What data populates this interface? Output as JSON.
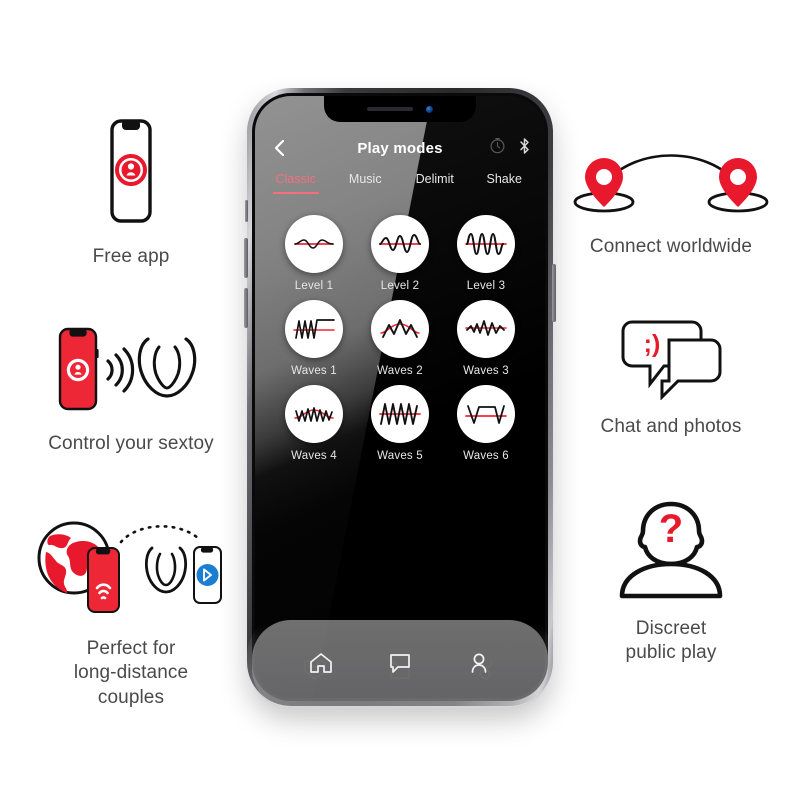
{
  "phone": {
    "header": {
      "back_icon": "chevron-left-icon",
      "title": "Play modes",
      "timer_icon": "timer-icon",
      "bluetooth_icon": "bluetooth-icon"
    },
    "tabs": [
      {
        "label": "Classic",
        "active": true
      },
      {
        "label": "Music",
        "active": false
      },
      {
        "label": "Delimit",
        "active": false
      },
      {
        "label": "Shake",
        "active": false
      }
    ],
    "modes": [
      {
        "label": "Level 1",
        "wave": "level1"
      },
      {
        "label": "Level 2",
        "wave": "level2"
      },
      {
        "label": "Level 3",
        "wave": "level3"
      },
      {
        "label": "Waves 1",
        "wave": "waves1"
      },
      {
        "label": "Waves 2",
        "wave": "waves2"
      },
      {
        "label": "Waves 3",
        "wave": "waves3"
      },
      {
        "label": "Waves 4",
        "wave": "waves4"
      },
      {
        "label": "Waves 5",
        "wave": "waves5"
      },
      {
        "label": "Waves 6",
        "wave": "waves6"
      }
    ],
    "bottom_nav": [
      {
        "icon": "home-icon"
      },
      {
        "icon": "chat-icon"
      },
      {
        "icon": "profile-icon"
      }
    ]
  },
  "features": {
    "free_app": {
      "caption": "Free app",
      "icon": "phone-with-app-logo-icon"
    },
    "control": {
      "caption": "Control your sextoy",
      "icon": "phone-signal-toy-icon"
    },
    "distance": {
      "caption": "Perfect for\nlong-distance\ncouples",
      "icon": "globe-phone-toy-bluetooth-icon"
    },
    "connect": {
      "caption": "Connect worldwide",
      "icon": "two-map-pins-arc-icon"
    },
    "chat": {
      "caption": "Chat and photos",
      "icon": "speech-bubbles-wink-icon",
      "emoticon": ";)"
    },
    "discreet": {
      "caption": "Discreet\npublic play",
      "icon": "anonymous-person-question-icon"
    }
  },
  "colors": {
    "brand_red": "#e8192c",
    "accent_pink": "#f4717c",
    "bluetooth_blue": "#1a7ed1",
    "caption_gray": "#4a4a4a",
    "screen_black": "#000000"
  }
}
